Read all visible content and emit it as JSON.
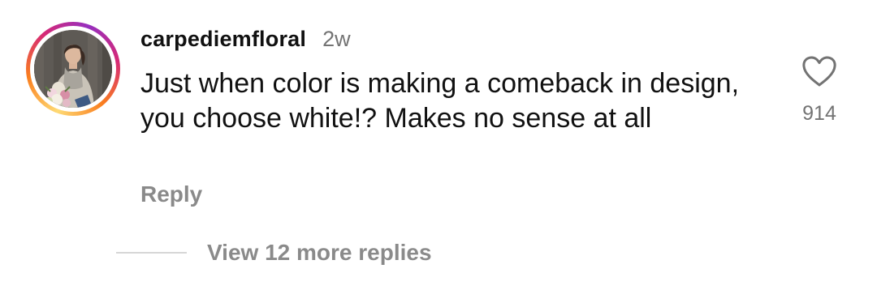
{
  "comment": {
    "username": "carpediemfloral",
    "timestamp": "2w",
    "text": "Just when color is making a comeback in design, you choose white!? Makes no sense at all",
    "reply_label": "Reply",
    "likes": "914",
    "view_replies_label": "View 12 more replies",
    "avatar_icon": "profile-photo",
    "heart_icon": "heart-outline-icon"
  },
  "colors": {
    "primary_text": "#111111",
    "secondary_text": "#737373",
    "action_text": "#8a8a8a",
    "story_ring": [
      "#feda75",
      "#fa7e1e",
      "#d62976",
      "#962fbf"
    ]
  }
}
